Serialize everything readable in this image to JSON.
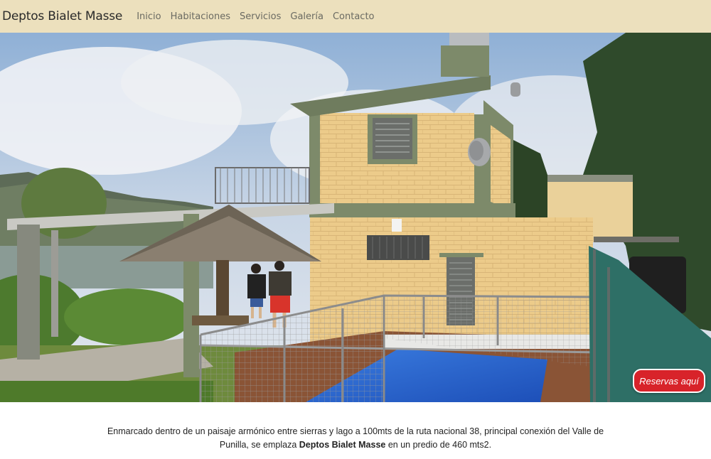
{
  "navbar": {
    "brand": "Deptos Bialet Masse",
    "links": [
      "Inicio",
      "Habitaciones",
      "Servicios",
      "Galería",
      "Contacto"
    ]
  },
  "hero": {
    "image_description_icon": "house-with-pool-photo"
  },
  "reservas_button": "Reservas aquí",
  "intro": {
    "text_before": "Enmarcado dentro de un paisaje armónico entre sierras y lago a 100mts de la ruta nacional 38, principal conexión del Valle de Punilla, se emplaza ",
    "highlight": "Deptos Bialet Masse",
    "text_after": " en un predio de 460 mts2."
  },
  "colors": {
    "navbar_bg": "#ece0bd",
    "button_red": "#d8232a",
    "wall_yellow": "#eccb8a",
    "trim_green": "#7d8a6a"
  }
}
